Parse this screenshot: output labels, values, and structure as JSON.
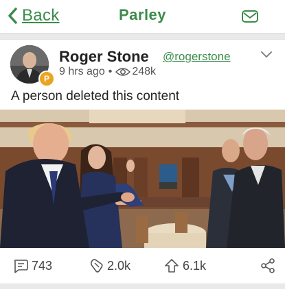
{
  "header": {
    "back_label": "Back",
    "title": "Parley",
    "back_icon": "chevron-left-icon",
    "inbox_icon": "envelope-icon"
  },
  "post": {
    "author_name": "Roger Stone",
    "author_handle": "@rogerstone",
    "time_ago": "9 hrs ago",
    "separator": "•",
    "views": "248k",
    "content": "A person deleted this content",
    "badge_glyph": "P",
    "actions": {
      "comments": "743",
      "echoes": "2.0k",
      "upvotes": "6.1k"
    }
  },
  "colors": {
    "accent": "#3a8c49",
    "badge": "#e9a422"
  }
}
